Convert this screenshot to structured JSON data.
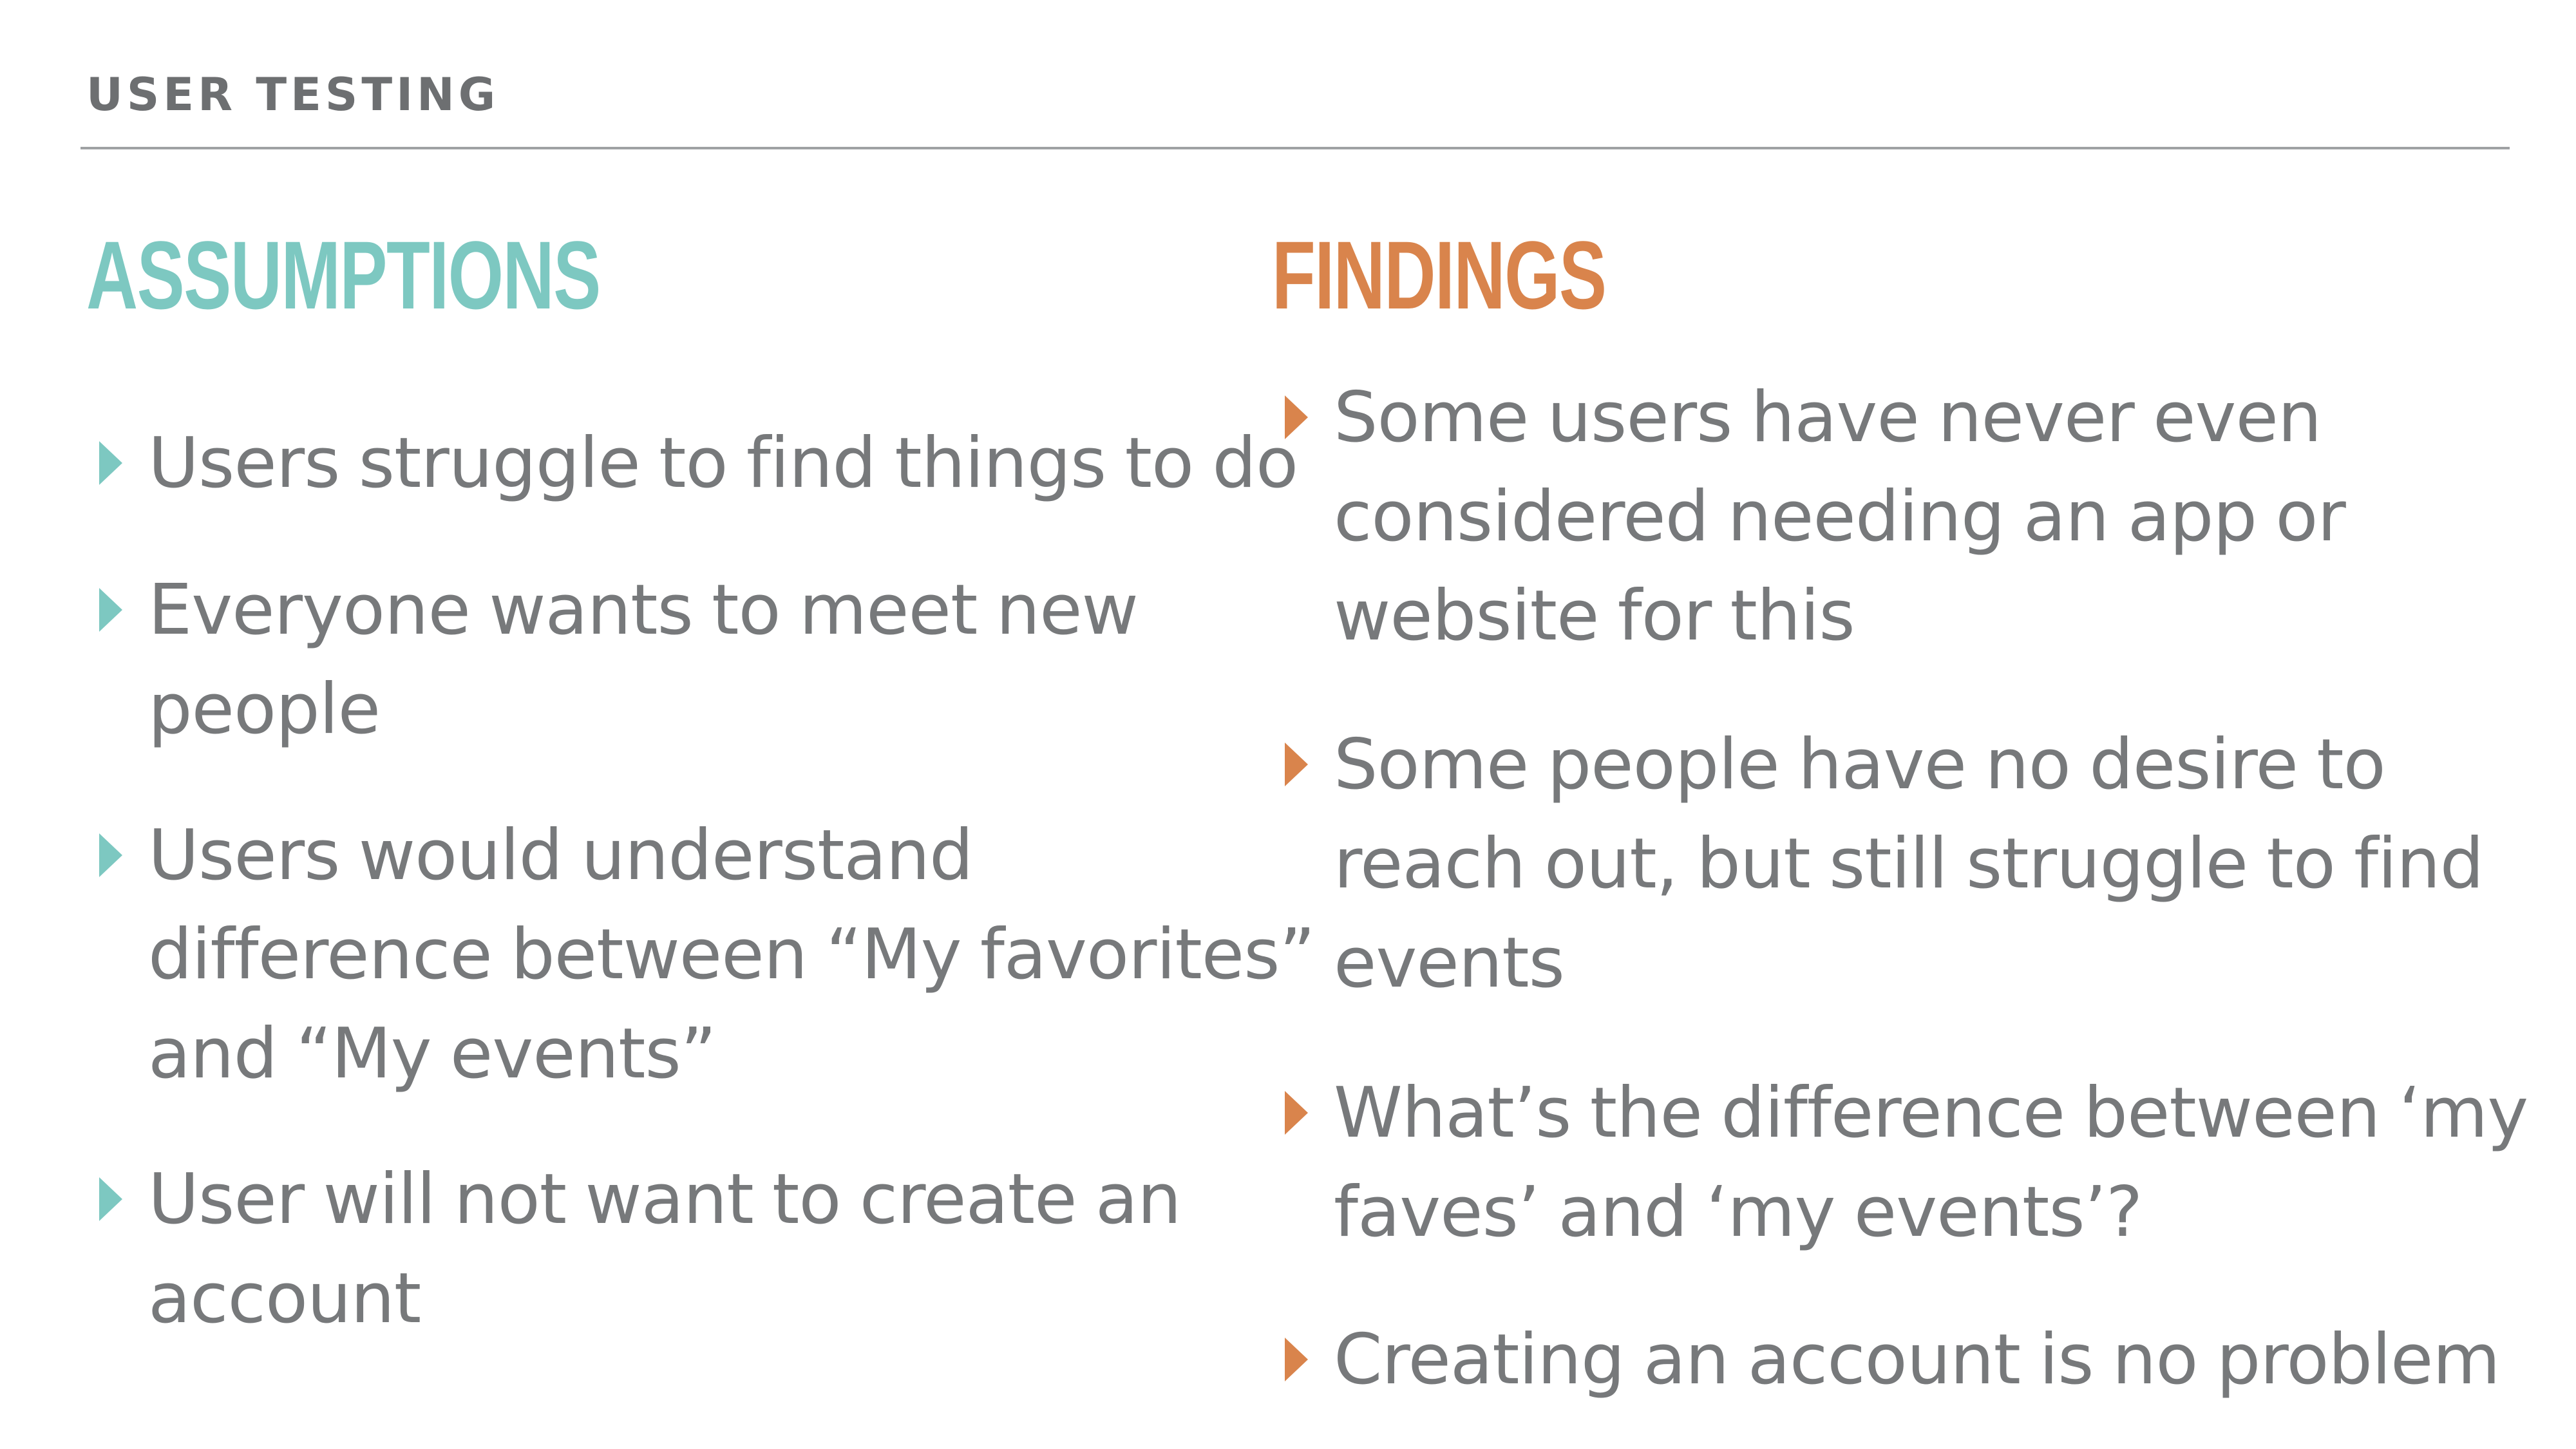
{
  "header": {
    "title": "USER TESTING"
  },
  "assumptions": {
    "heading": "ASSUMPTIONS",
    "items": [
      "Users struggle to find things to do",
      "Everyone wants to meet new\npeople",
      "Users would understand\ndifference between “My favorites”\nand “My events”",
      "User will not want to create an\naccount"
    ]
  },
  "findings": {
    "heading": "FINDINGS",
    "items": [
      "Some users have never even\nconsidered needing an app or\nwebsite for this",
      "Some people have no desire to\nreach out, but still struggle to find\nevents",
      "What’s the difference between ‘my\nfaves’ and ‘my events’?",
      "Creating an account is no problem"
    ]
  },
  "colors": {
    "assumptions_accent": "#7dc8c1",
    "findings_accent": "#d9844c",
    "body_text": "#77797b",
    "rule": "#9fa1a3"
  }
}
